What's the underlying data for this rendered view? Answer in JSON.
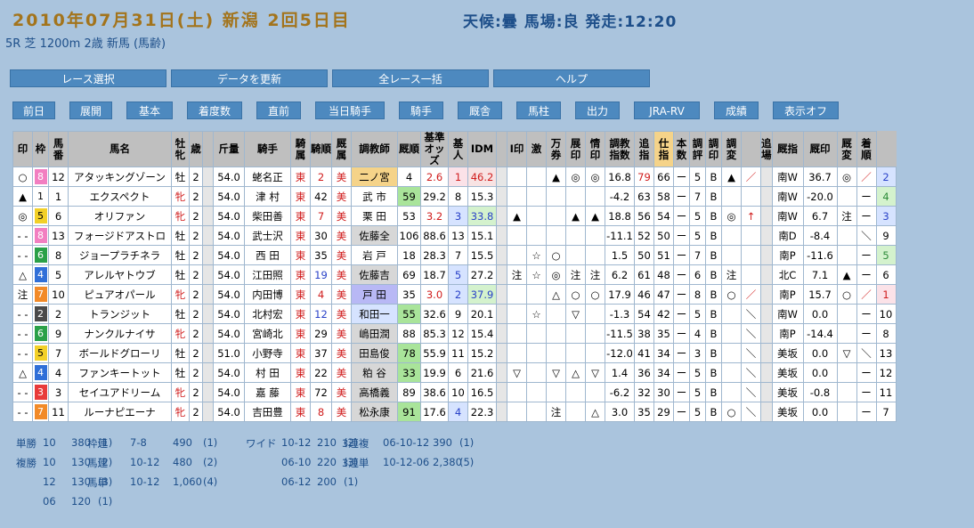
{
  "header": {
    "date": "2010年07月31日(土) 新潟 2回5日目",
    "weather": "天候:曇 馬場:良 発走:12:20",
    "subtitle": "5R 芝 1200m 2歳 新馬 (馬齢)"
  },
  "big_buttons": [
    "レース選択",
    "データを更新",
    "全レース一括",
    "ヘルプ"
  ],
  "small_buttons": [
    "前日",
    "展開",
    "基本",
    "着度数",
    "直前",
    "当日騎手",
    "騎手",
    "厩舎",
    "馬柱",
    "出力",
    "JRA-RV",
    "成績",
    "表示オフ"
  ],
  "table": {
    "headers": [
      "印",
      "枠",
      "馬番",
      "馬名",
      "牡牝",
      "歳",
      "",
      "斤量",
      "騎手",
      "騎属",
      "騎順",
      "厩属",
      "調教師",
      "厩順",
      "基準オッズ",
      "基人",
      "IDM",
      "",
      "I印",
      "激",
      "万券",
      "展印",
      "情印",
      "調教指数",
      "追指",
      "仕指",
      "本数",
      "調評",
      "調印",
      "調変",
      "",
      "追場",
      "厩指",
      "厩印",
      "厩変",
      "着順"
    ],
    "rows": [
      [
        "○",
        "8",
        "12",
        "アタッキングゾーン",
        "牡",
        "2",
        "",
        "54.0",
        "蛯名正",
        "東",
        "2",
        "美",
        "二ノ宮",
        "4",
        "2.6",
        "1",
        "46.2",
        "",
        "",
        "",
        "▲",
        "◎",
        "◎",
        "16.8",
        "79",
        "66",
        "ー",
        "5",
        "B",
        "▲",
        "／",
        "",
        "南W",
        "36.7",
        "◎",
        "／",
        "2"
      ],
      [
        "▲",
        "1",
        "1",
        "エクスペクト",
        "牝",
        "2",
        "",
        "54.0",
        "津 村",
        "東",
        "42",
        "美",
        "武 市",
        "59",
        "29.2",
        "8",
        "15.3",
        "",
        "",
        "",
        "",
        "",
        "",
        "-4.2",
        "63",
        "58",
        "ー",
        "7",
        "B",
        "",
        "",
        "",
        "南W",
        "-20.0",
        "",
        "ー",
        "4"
      ],
      [
        "◎",
        "5",
        "6",
        "オリファン",
        "牝",
        "2",
        "",
        "54.0",
        "柴田善",
        "東",
        "7",
        "美",
        "栗 田",
        "53",
        "3.2",
        "3",
        "33.8",
        "",
        "▲",
        "",
        "",
        "▲",
        "▲",
        "18.8",
        "56",
        "54",
        "ー",
        "5",
        "B",
        "◎",
        "↑",
        "",
        "南W",
        "6.7",
        "注",
        "ー",
        "3"
      ],
      [
        "- -",
        "8",
        "13",
        "フォージドアストロ",
        "牡",
        "2",
        "",
        "54.0",
        "武士沢",
        "東",
        "30",
        "美",
        "佐藤全",
        "106",
        "88.6",
        "13",
        "15.1",
        "",
        "",
        "",
        "",
        "",
        "",
        "-11.1",
        "52",
        "50",
        "ー",
        "5",
        "B",
        "",
        "",
        "",
        "南D",
        "-8.4",
        "",
        "＼",
        "9"
      ],
      [
        "- -",
        "6",
        "8",
        "ジョープラチネラ",
        "牡",
        "2",
        "",
        "54.0",
        "西 田",
        "東",
        "35",
        "美",
        "岩 戸",
        "18",
        "28.3",
        "7",
        "15.5",
        "",
        "",
        "☆",
        "○",
        "",
        "",
        "1.5",
        "50",
        "51",
        "ー",
        "7",
        "B",
        "",
        "",
        "",
        "南P",
        "-11.6",
        "",
        "ー",
        "5"
      ],
      [
        "△",
        "4",
        "5",
        "アレルヤトウブ",
        "牡",
        "2",
        "",
        "54.0",
        "江田照",
        "東",
        "19",
        "美",
        "佐藤吉",
        "69",
        "18.7",
        "5",
        "27.2",
        "",
        "注",
        "☆",
        "◎",
        "注",
        "注",
        "6.2",
        "61",
        "48",
        "ー",
        "6",
        "B",
        "注",
        "",
        "",
        "北C",
        "7.1",
        "▲",
        "ー",
        "6"
      ],
      [
        "注",
        "7",
        "10",
        "ピュアオパール",
        "牝",
        "2",
        "",
        "54.0",
        "内田博",
        "東",
        "4",
        "美",
        "戸 田",
        "35",
        "3.0",
        "2",
        "37.9",
        "",
        "",
        "",
        "△",
        "○",
        "○",
        "17.9",
        "46",
        "47",
        "ー",
        "8",
        "B",
        "○",
        "／",
        "",
        "南P",
        "15.7",
        "○",
        "／",
        "1"
      ],
      [
        "- -",
        "2",
        "2",
        "トランジット",
        "牡",
        "2",
        "",
        "54.0",
        "北村宏",
        "東",
        "12",
        "美",
        "和田一",
        "55",
        "32.6",
        "9",
        "20.1",
        "",
        "",
        "☆",
        "",
        "▽",
        "",
        "-1.3",
        "54",
        "42",
        "ー",
        "5",
        "B",
        "",
        "＼",
        "",
        "南W",
        "0.0",
        "",
        "ー",
        "10"
      ],
      [
        "- -",
        "6",
        "9",
        "ナンクルナイサ",
        "牝",
        "2",
        "",
        "54.0",
        "宮崎北",
        "東",
        "29",
        "美",
        "嶋田潤",
        "88",
        "85.3",
        "12",
        "15.4",
        "",
        "",
        "",
        "",
        "",
        "",
        "-11.5",
        "38",
        "35",
        "ー",
        "4",
        "B",
        "",
        "＼",
        "",
        "南P",
        "-14.4",
        "",
        "ー",
        "8"
      ],
      [
        "- -",
        "5",
        "7",
        "ボールドグローリ",
        "牡",
        "2",
        "",
        "51.0",
        "小野寺",
        "東",
        "37",
        "美",
        "田島俊",
        "78",
        "55.9",
        "11",
        "15.2",
        "",
        "",
        "",
        "",
        "",
        "",
        "-12.0",
        "41",
        "34",
        "ー",
        "3",
        "B",
        "",
        "＼",
        "",
        "美坂",
        "0.0",
        "▽",
        "＼",
        "13"
      ],
      [
        "△",
        "4",
        "4",
        "ファンキートット",
        "牡",
        "2",
        "",
        "54.0",
        "村 田",
        "東",
        "22",
        "美",
        "粕 谷",
        "33",
        "19.9",
        "6",
        "21.6",
        "",
        "▽",
        "",
        "▽",
        "△",
        "▽",
        "1.4",
        "36",
        "34",
        "ー",
        "5",
        "B",
        "",
        "＼",
        "",
        "美坂",
        "0.0",
        "",
        "ー",
        "12"
      ],
      [
        "- -",
        "3",
        "3",
        "セイユアドリーム",
        "牝",
        "2",
        "",
        "54.0",
        "嘉 藤",
        "東",
        "72",
        "美",
        "高橋義",
        "89",
        "38.6",
        "10",
        "16.5",
        "",
        "",
        "",
        "",
        "",
        "",
        "-6.2",
        "32",
        "30",
        "ー",
        "5",
        "B",
        "",
        "＼",
        "",
        "美坂",
        "-0.8",
        "",
        "ー",
        "11"
      ],
      [
        "- -",
        "7",
        "11",
        "ルーナピエーナ",
        "牝",
        "2",
        "",
        "54.0",
        "吉田豊",
        "東",
        "8",
        "美",
        "松永康",
        "91",
        "17.6",
        "4",
        "22.3",
        "",
        "",
        "",
        "注",
        "",
        "△",
        "3.0",
        "35",
        "29",
        "ー",
        "5",
        "B",
        "○",
        "＼",
        "",
        "美坂",
        "0.0",
        "",
        "ー",
        "7"
      ]
    ]
  },
  "payouts": {
    "c1": [
      [
        "単勝",
        "10",
        "380",
        "(1)"
      ],
      [
        "複勝",
        "10",
        "130",
        "(2)"
      ],
      [
        "",
        "12",
        "130",
        "(3)"
      ],
      [
        "",
        "06",
        "120",
        "(1)"
      ]
    ],
    "c2": [
      [
        "枠連",
        "7-8",
        "490",
        "(1)"
      ],
      [
        "馬連",
        "10-12",
        "480",
        "(2)"
      ],
      [
        "馬単",
        "10-12",
        "1,060",
        "(4)"
      ]
    ],
    "c3": [
      [
        "ワイド",
        "10-12",
        "210",
        "(2)"
      ],
      [
        "",
        "06-10",
        "220",
        "(3)"
      ],
      [
        "",
        "06-12",
        "200",
        "(1)"
      ]
    ],
    "c4": [
      [
        "3連複",
        "06-10-12",
        "390",
        "(1)"
      ],
      [
        "3連単",
        "10-12-06",
        "2,380",
        "(5)"
      ]
    ]
  },
  "colors": {
    "background": "#aac4dd",
    "button": "#4d89bf",
    "header_gold": "#a3741c",
    "header_blue": "#1e4f8a"
  }
}
